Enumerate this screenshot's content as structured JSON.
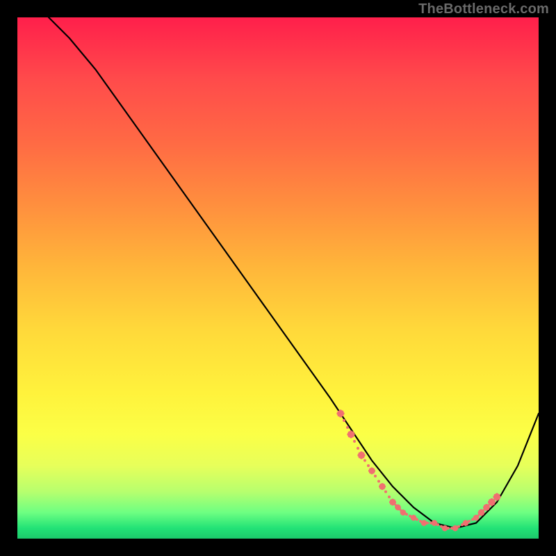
{
  "watermark": "TheBottleneck.com",
  "chart_data": {
    "type": "line",
    "title": "",
    "xlabel": "",
    "ylabel": "",
    "xlim": [
      0,
      100
    ],
    "ylim": [
      0,
      100
    ],
    "series": [
      {
        "name": "curve",
        "color": "#000000",
        "x": [
          6,
          10,
          15,
          20,
          25,
          30,
          35,
          40,
          45,
          50,
          55,
          60,
          64,
          68,
          72,
          76,
          80,
          84,
          88,
          92,
          96,
          100
        ],
        "y": [
          100,
          96,
          90,
          83,
          76,
          69,
          62,
          55,
          48,
          41,
          34,
          27,
          21,
          15,
          10,
          6,
          3,
          2,
          3,
          7,
          14,
          24
        ]
      }
    ],
    "highlight_band": {
      "color": "#f07070",
      "x": [
        62,
        64,
        66,
        68,
        70,
        72,
        73,
        74,
        76,
        78,
        80,
        82,
        84,
        86,
        88,
        89,
        90,
        91,
        92
      ],
      "y": [
        24,
        20,
        16,
        13,
        10,
        7,
        6,
        5,
        4,
        3,
        3,
        2,
        2,
        3,
        4,
        5,
        6,
        7,
        8
      ],
      "thickness": [
        6,
        6,
        6,
        5,
        5,
        5,
        4,
        4,
        4,
        4,
        4,
        4,
        4,
        4,
        4,
        5,
        5,
        6,
        6
      ]
    }
  }
}
